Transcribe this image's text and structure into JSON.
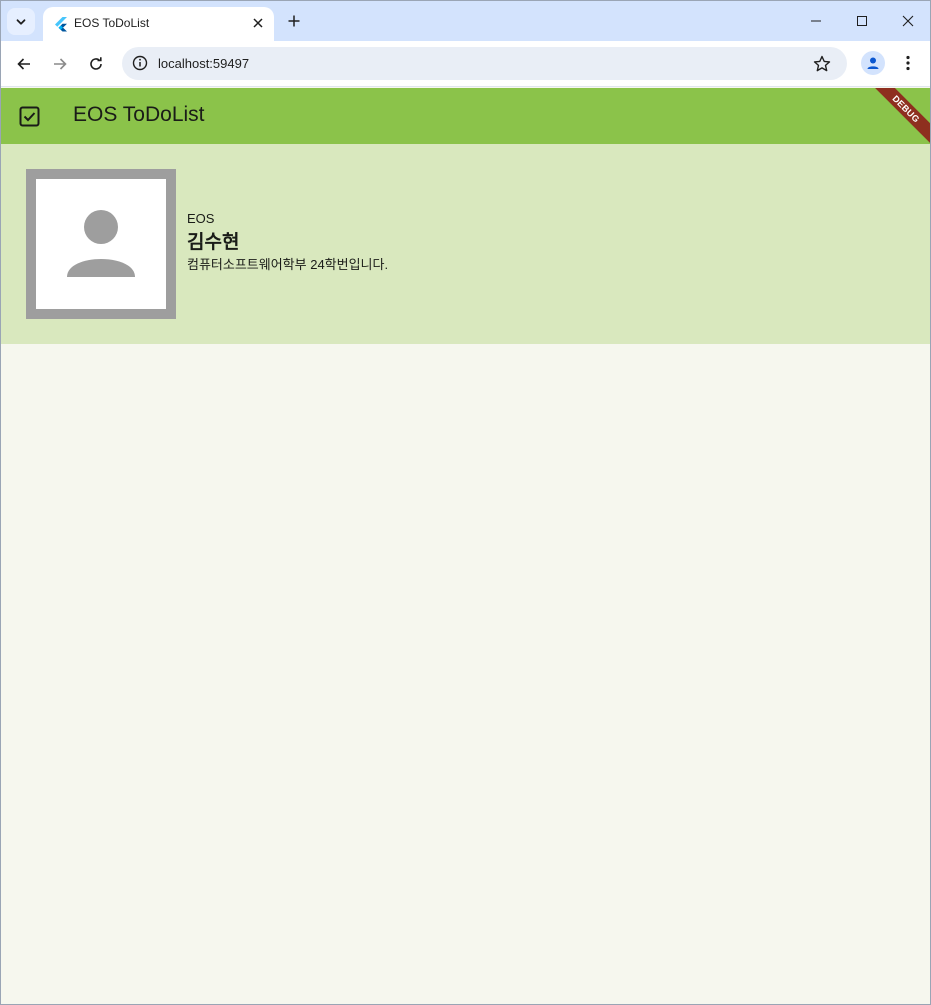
{
  "browser": {
    "tab_title": "EOS ToDoList",
    "url": "localhost:59497"
  },
  "app": {
    "title": "EOS ToDoList",
    "debug_banner": "DEBUG",
    "colors": {
      "appbar": "#8bc34a",
      "profile_card": "#d9e8be",
      "background": "#f6f7ee",
      "avatar_frame": "#9e9e9e"
    }
  },
  "profile": {
    "organization": "EOS",
    "name": "김수현",
    "description": "컴퓨터소프트웨어학부 24학번입니다."
  },
  "icons": {
    "tab_search": "chevron-down-icon",
    "favicon": "flutter-icon",
    "appbar": "checkbox-checked-icon",
    "avatar": "person-icon"
  }
}
